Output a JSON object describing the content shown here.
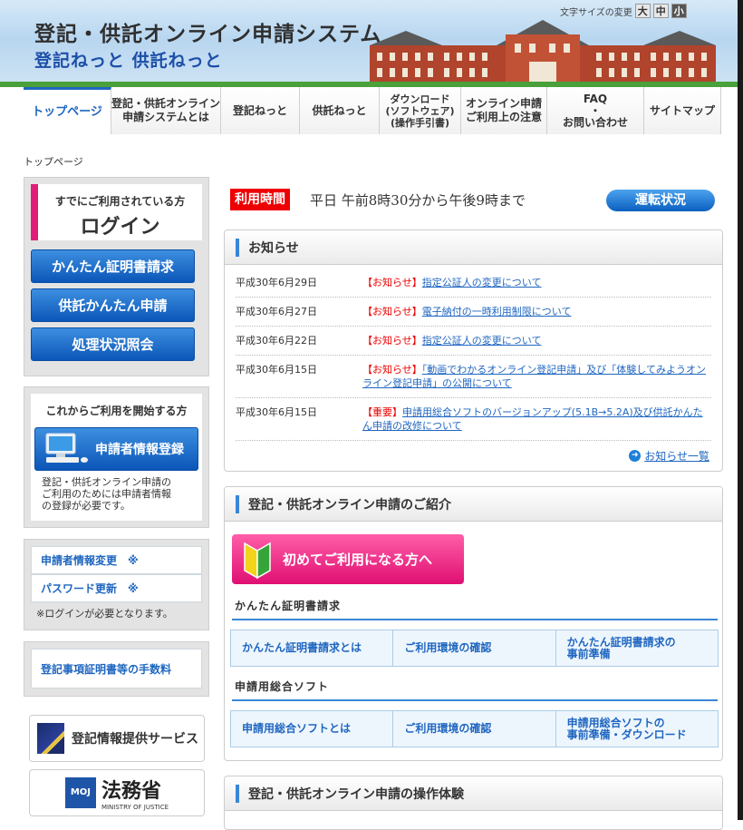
{
  "header": {
    "title": "登記・供託オンライン申請システム",
    "subtitle": "登記ねっと 供託ねっと",
    "fontsize_label": "文字サイズの変更",
    "fontsize_options": [
      "大",
      "中",
      "小"
    ]
  },
  "nav": [
    "トップページ",
    "登記・供託オンライン\n申請システムとは",
    "登記ねっと",
    "供託ねっと",
    "ダウンロード\n(ソフトウェア)\n(操作手引書)",
    "オンライン申請\nご利用上の注意",
    "FAQ\n・\nお問い合わせ",
    "サイトマップ"
  ],
  "breadcrumb": "トップページ",
  "login": {
    "sub": "すでにご利用されている方",
    "title": "ログイン",
    "buttons": [
      "かんたん証明書請求",
      "供託かんたん申請",
      "処理状況照会"
    ]
  },
  "register": {
    "title": "これからご利用を開始する方",
    "button": "申請者情報登録",
    "note": "登記・供託オンライン申請の\nご利用のためには申請者情報\nの登録が必要です。"
  },
  "account": {
    "links": [
      "申請者情報変更　※",
      "パスワード更新　※"
    ],
    "note": "※ログインが必要となります。"
  },
  "fee_link": "登記事項証明書等の手数料",
  "banners": {
    "touki": "登記情報提供サービス",
    "moj": "法務省",
    "moj_en": "MINISTRY OF JUSTICE",
    "moj_logo": "MOJ"
  },
  "hours": {
    "label": "利用時間",
    "text": "平日 午前8時30分から午後9時まで"
  },
  "status_button": "運転状況",
  "news": {
    "title": "お知らせ",
    "items": [
      {
        "date": "平成30年6月29日",
        "cat": "【お知らせ】",
        "text": "指定公証人の変更について"
      },
      {
        "date": "平成30年6月27日",
        "cat": "【お知らせ】",
        "text": "電子納付の一時利用制限について"
      },
      {
        "date": "平成30年6月22日",
        "cat": "【お知らせ】",
        "text": "指定公証人の変更について"
      },
      {
        "date": "平成30年6月15日",
        "cat": "【お知らせ】",
        "text": "「動画でわかるオンライン登記申請」及び「体験してみようオンライン登記申請」の公開について"
      },
      {
        "date": "平成30年6月15日",
        "cat": "【重要】",
        "text": "申請用総合ソフトのバージョンアップ(5.1B→5.2A)及び供託かんたん申請の改修について"
      }
    ],
    "more": "お知らせ一覧"
  },
  "intro": {
    "title": "登記・供託オンライン申請のご紹介",
    "first_button": "初めてご利用になる方へ",
    "sections": [
      {
        "title": "かんたん証明書請求",
        "cells": [
          "かんたん証明書請求とは",
          "ご利用環境の確認",
          "かんたん証明書請求の\n事前準備"
        ]
      },
      {
        "title": "申請用総合ソフト",
        "cells": [
          "申請用総合ソフトとは",
          "ご利用環境の確認",
          "申請用総合ソフトの\n事前準備・ダウンロード"
        ]
      }
    ]
  },
  "experience": {
    "title": "登記・供託オンライン申請の操作体験"
  },
  "colors": {
    "accent": "#1f66c0",
    "alert": "#ee0000",
    "pink": "#df0f72"
  }
}
